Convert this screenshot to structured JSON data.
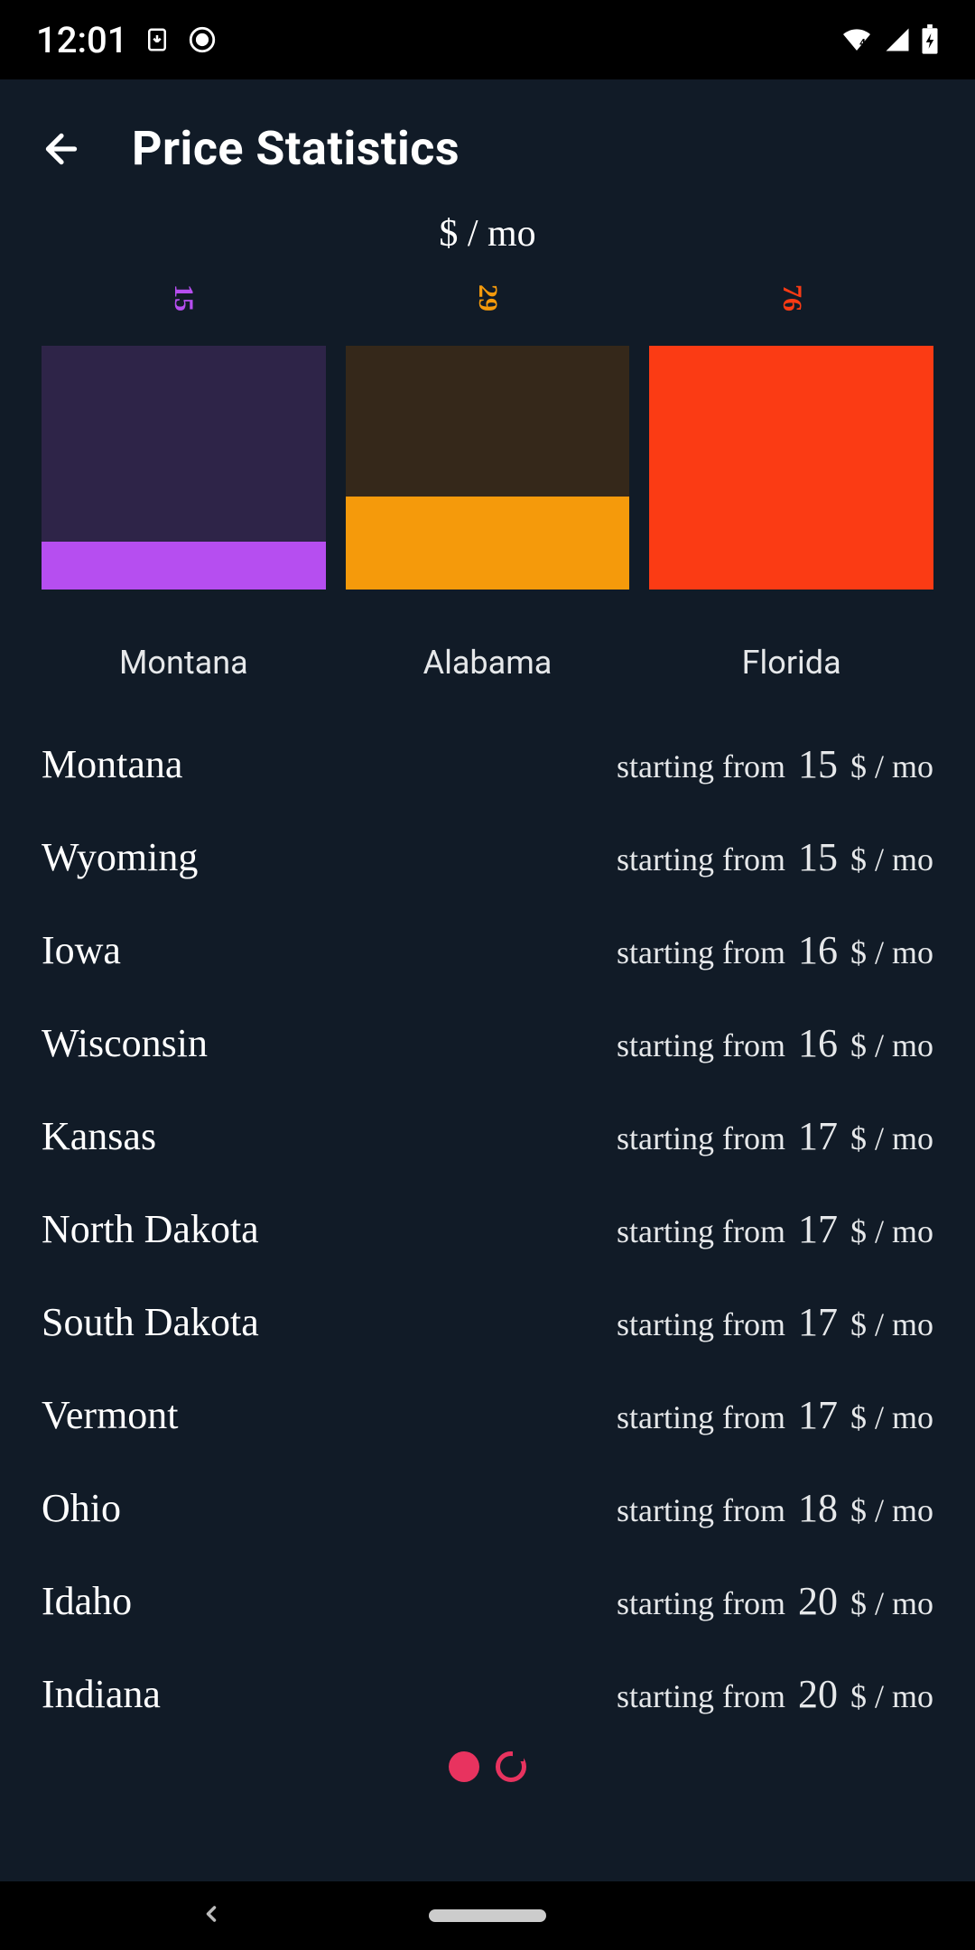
{
  "statusbar": {
    "time": "12:01"
  },
  "appbar": {
    "title": "Price Statistics"
  },
  "unit_label": "$ / mo",
  "chart_data": {
    "type": "bar",
    "categories": [
      "Montana",
      "Alabama",
      "Florida"
    ],
    "values": [
      15,
      29,
      76
    ],
    "ylabel": "$ / mo",
    "ylim": [
      0,
      76
    ],
    "series_colors": [
      "#b64ef0",
      "#f59a0b",
      "#fb3b14"
    ],
    "bg_colors": [
      "#2e2448",
      "#35281a",
      "#3a1810"
    ]
  },
  "price_prefix": "starting from",
  "price_unit": "$ / mo",
  "list": [
    {
      "state": "Montana",
      "price": "15"
    },
    {
      "state": "Wyoming",
      "price": "15"
    },
    {
      "state": "Iowa",
      "price": "16"
    },
    {
      "state": "Wisconsin",
      "price": "16"
    },
    {
      "state": "Kansas",
      "price": "17"
    },
    {
      "state": "North Dakota",
      "price": "17"
    },
    {
      "state": "South Dakota",
      "price": "17"
    },
    {
      "state": "Vermont",
      "price": "17"
    },
    {
      "state": "Ohio",
      "price": "18"
    },
    {
      "state": "Idaho",
      "price": "20"
    },
    {
      "state": "Indiana",
      "price": "20"
    }
  ],
  "pager": {
    "count": 2,
    "active": 0
  }
}
